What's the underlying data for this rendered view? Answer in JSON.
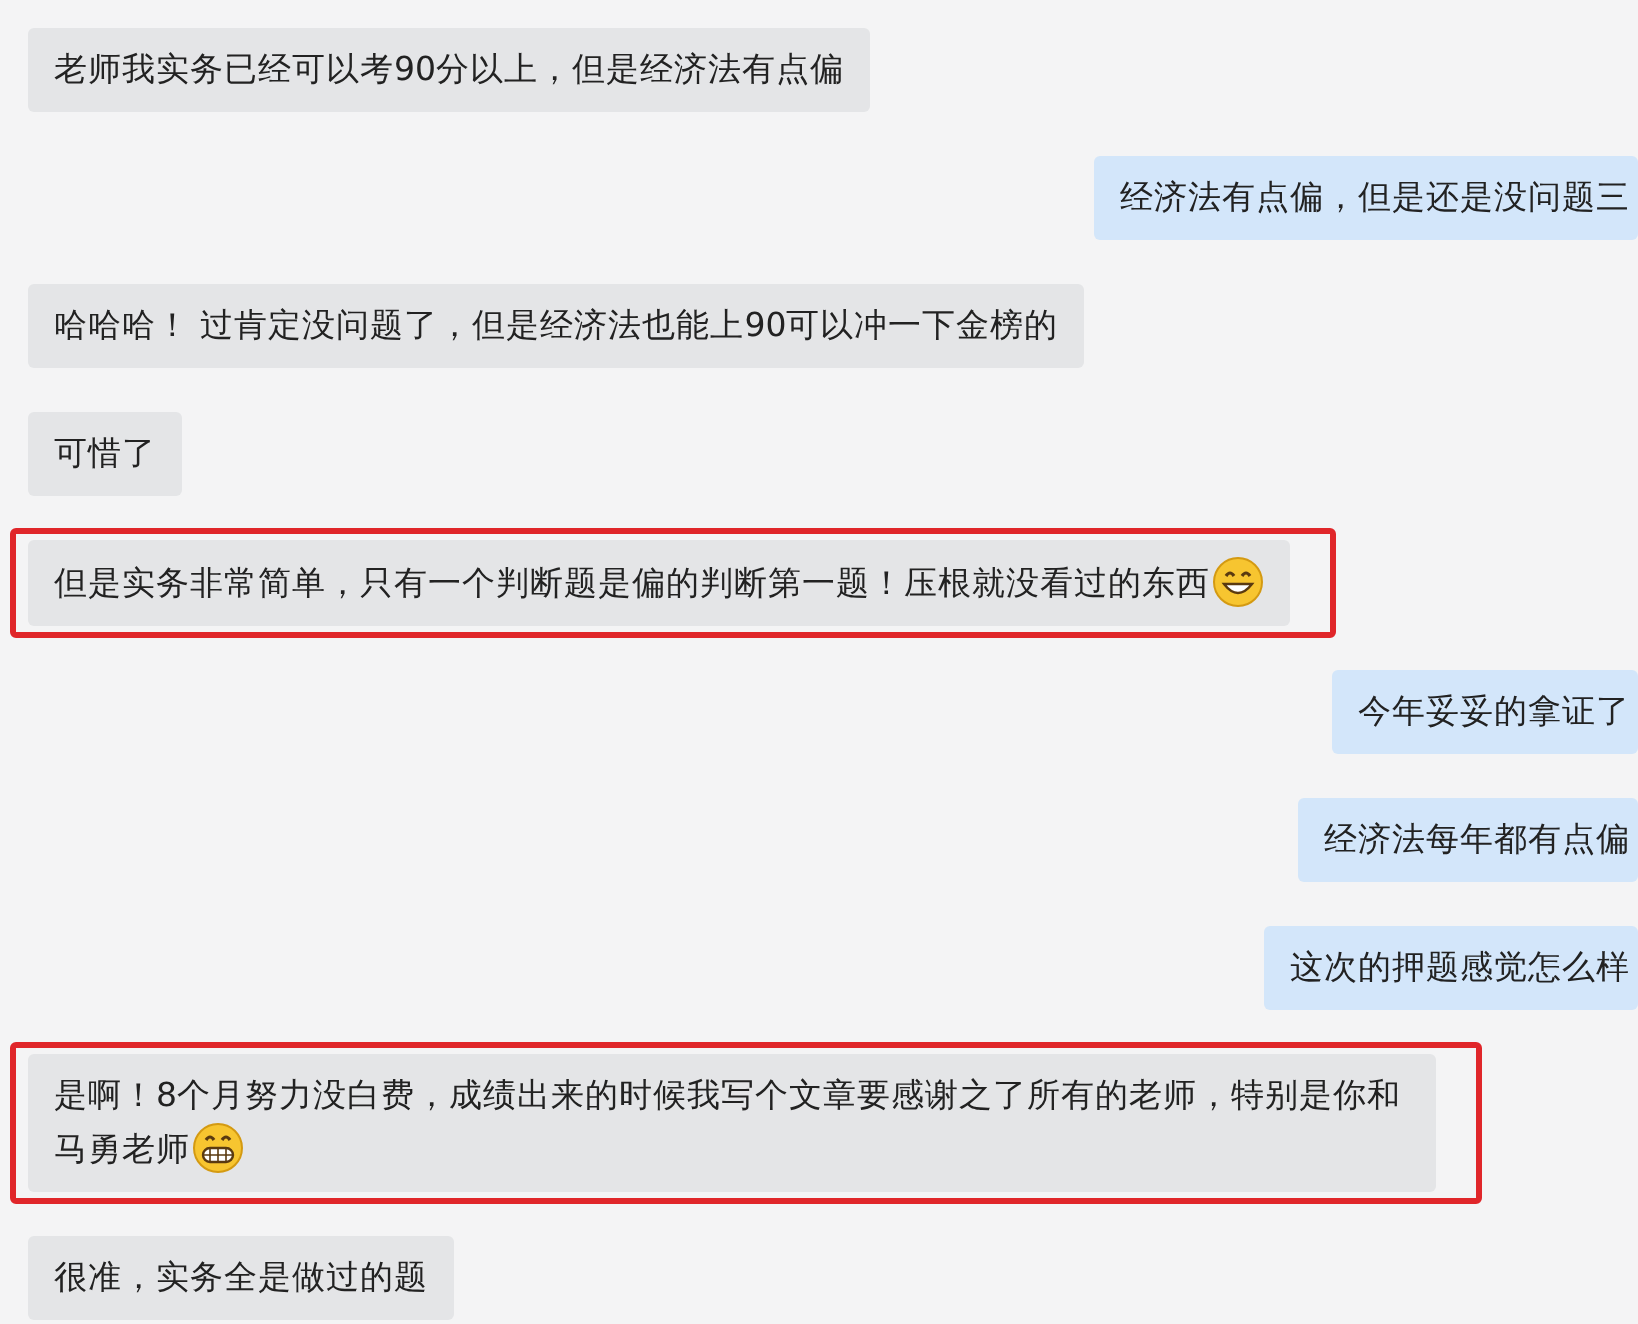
{
  "messages": [
    {
      "kind": "incoming",
      "text": "老师我实务已经可以考90分以上，但是经济法有点偏",
      "highlighted": false
    },
    {
      "kind": "outgoing",
      "text": "经济法有点偏，但是还是没问题三",
      "highlighted": false
    },
    {
      "kind": "incoming",
      "text": "哈哈哈！ 过肯定没问题了，但是经济法也能上90可以冲一下金榜的",
      "highlighted": false
    },
    {
      "kind": "incoming",
      "text": "可惜了",
      "highlighted": false
    },
    {
      "kind": "incoming",
      "text": "但是实务非常简单，只有一个判断题是偏的判断第一题！压根就没看过的东西",
      "highlighted": true,
      "emoji": {
        "kind": "smile"
      }
    },
    {
      "kind": "outgoing",
      "text": "今年妥妥的拿证了",
      "highlighted": false
    },
    {
      "kind": "outgoing",
      "text": "经济法每年都有点偏",
      "highlighted": false
    },
    {
      "kind": "outgoing",
      "text": "这次的押题感觉怎么样",
      "highlighted": false
    },
    {
      "kind": "incoming",
      "text": "是啊！8个月努力没白费，成绩出来的时候我写个文章要感谢之了所有的老师，特别是你和马勇老师",
      "highlighted": true,
      "emoji": {
        "kind": "grin"
      }
    },
    {
      "kind": "incoming",
      "text": "很准，实务全是做过的题",
      "highlighted": false
    }
  ]
}
